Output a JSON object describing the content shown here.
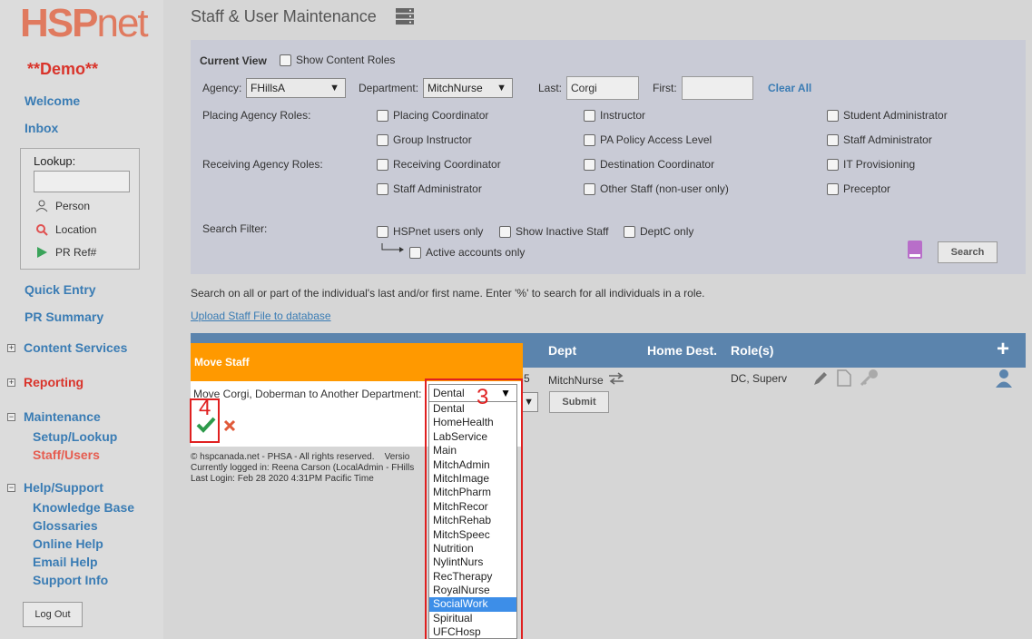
{
  "sidebar": {
    "logo_main": "HSP",
    "logo_sub": "net",
    "demo": "**Demo**",
    "welcome": "Welcome",
    "inbox": "Inbox",
    "lookup_label": "Lookup:",
    "person": "Person",
    "location": "Location",
    "prref": "PR Ref#",
    "quick_entry": "Quick Entry",
    "pr_summary": "PR Summary",
    "content_services": "Content Services",
    "reporting": "Reporting",
    "maintenance": "Maintenance",
    "setup_lookup": "Setup/Lookup",
    "staff_users": "Staff/Users",
    "help_support": "Help/Support",
    "knowledge_base": "Knowledge Base",
    "glossaries": "Glossaries",
    "online_help": "Online Help",
    "email_help": "Email Help",
    "support_info": "Support Info",
    "logout": "Log Out",
    "collapse_plus": "+",
    "collapse_minus": "−"
  },
  "header": {
    "title": "Staff & User Maintenance"
  },
  "filter": {
    "current_view": "Current View",
    "show_content_roles": "Show Content Roles",
    "agency_label": "Agency:",
    "agency_value": "FHillsA",
    "department_label": "Department:",
    "department_value": "MitchNurse",
    "last_label": "Last:",
    "last_value": "Corgi",
    "first_label": "First:",
    "first_value": "",
    "clear_all": "Clear All",
    "placing_roles_label": "Placing Agency Roles:",
    "receiving_roles_label": "Receiving Agency Roles:",
    "roles": {
      "placing_coordinator": "Placing Coordinator",
      "instructor": "Instructor",
      "student_administrator": "Student Administrator",
      "group_instructor": "Group Instructor",
      "pa_policy": "PA Policy Access Level",
      "staff_administrator": "Staff Administrator",
      "receiving_coordinator": "Receiving Coordinator",
      "destination_coordinator": "Destination Coordinator",
      "it_provisioning": "IT Provisioning",
      "staff_administrator_r": "Staff Administrator",
      "other_staff": "Other Staff (non-user only)",
      "preceptor": "Preceptor"
    },
    "search_filter_label": "Search Filter:",
    "hspnet_users_only": "HSPnet users only",
    "show_inactive": "Show Inactive Staff",
    "deptc_only": "DeptC only",
    "active_accounts_only": "Active accounts only",
    "search_button": "Search"
  },
  "help_text": "Search on all or part of the individual's last and/or first name. Enter '%' to search for all individuals in a role.",
  "upload_link": "Upload Staff File to database",
  "table": {
    "col_dept": "Dept",
    "col_home_dest": "Home Dest.",
    "col_roles": "Role(s)",
    "add_symbol": "+",
    "row_num_fragment": "5",
    "row_dept": "MitchNurse",
    "row_roles": "DC, Superv",
    "submit": "Submit"
  },
  "move_dialog": {
    "title": "Move Staff",
    "prompt": "Move Corgi, Doberman to Another Department:",
    "selected": "Dental",
    "options": [
      "Dental",
      "HomeHealth",
      "LabService",
      "Main",
      "MitchAdmin",
      "MitchImage",
      "MitchPharm",
      "MitchRecor",
      "MitchRehab",
      "MitchSpeec",
      "Nutrition",
      "NylintNurs",
      "RecTherapy",
      "RoyalNurse",
      "SocialWork",
      "Spiritual",
      "UFCHosp"
    ],
    "highlighted": "SocialWork"
  },
  "annotations": {
    "label_3": "3",
    "label_4": "4"
  },
  "footer": {
    "line1": "© hspcanada.net - PHSA - All rights reserved.    Versio",
    "line2": "Currently logged in: Reena Carson (LocalAdmin - FHills",
    "line3": "Last Login: Feb 28 2020  4:31PM Pacific Time"
  },
  "colors": {
    "accent_orange": "#ff9900",
    "header_blue": "#5b84ad",
    "link_blue": "#3a7cb4",
    "brand_red": "#d9342b"
  }
}
